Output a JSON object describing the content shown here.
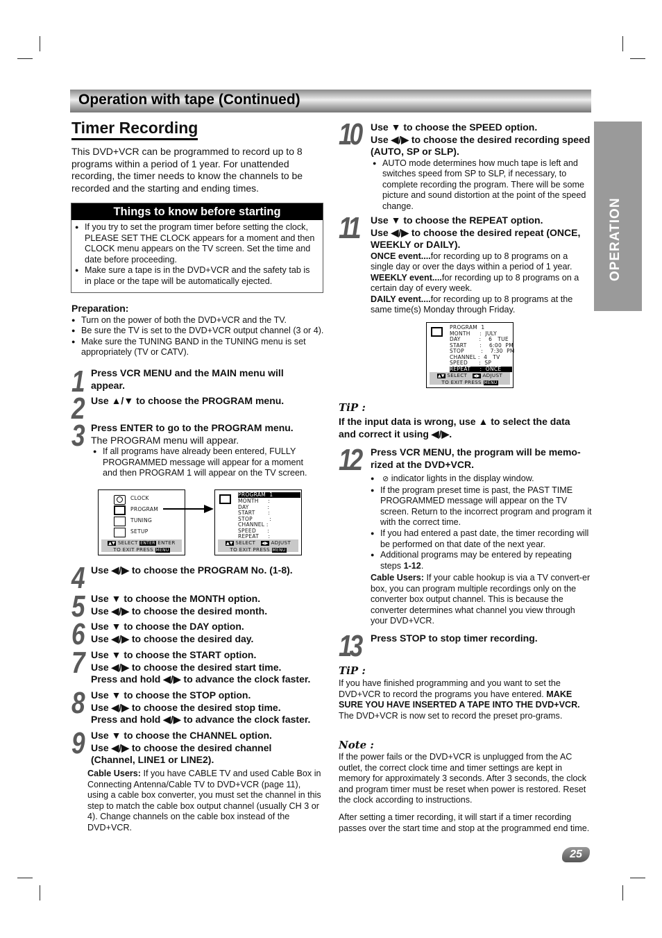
{
  "header": {
    "title": "Operation with tape (Continued)"
  },
  "section": {
    "title": "Timer Recording",
    "intro": "This DVD+VCR can be programmed to record up to 8 programs within a period of 1 year. For unattended recording, the timer needs to know the channels to be recorded and the starting and ending times."
  },
  "side_tab": {
    "label": "OPERATION"
  },
  "things": {
    "title": "Things to know before starting",
    "items": [
      "If you try to set the program timer before setting the clock, PLEASE SET THE CLOCK appears for a moment and then CLOCK menu appears on the TV screen. Set the time and date before proceeding.",
      "Make sure a tape is in the DVD+VCR and the safety tab is in place or the tape will  be automatically ejected."
    ]
  },
  "preparation": {
    "title": "Preparation:",
    "items": [
      "Turn on the power of both the DVD+VCR and the TV.",
      "Be sure the TV is set to the DVD+VCR output channel (3 or 4).",
      "Make sure the TUNING BAND in the TUNING menu is set appropriately (TV or CATV)."
    ]
  },
  "steps": {
    "s1": {
      "num": "1",
      "l1": "Press VCR MENU and the MAIN menu will appear."
    },
    "s2": {
      "num": "2",
      "l1": "Use ▲/▼ to choose the PROGRAM menu."
    },
    "s3": {
      "num": "3",
      "l1": "Press ENTER to go to the PROGRAM menu.",
      "body": "The PROGRAM menu will appear.",
      "bullet": "If all programs have already been entered, FULLY PROGRAMMED message will appear for a moment and then PROGRAM 1 will appear on the TV screen."
    },
    "s4": {
      "num": "4",
      "l1": "Use  ◀/▶ to choose the PROGRAM No. (1-8)."
    },
    "s5": {
      "num": "5",
      "l1": "Use ▼ to choose the MONTH option.",
      "l2": "Use ◀/▶ to choose the desired month."
    },
    "s6": {
      "num": "6",
      "l1": "Use ▼ to choose the DAY option.",
      "l2": "Use ◀/▶ to choose the desired day."
    },
    "s7": {
      "num": "7",
      "l1": "Use ▼ to choose the START option.",
      "l2": "Use ◀/▶ to choose the desired start time.",
      "l3": "Press and hold ◀/▶ to advance the clock faster."
    },
    "s8": {
      "num": "8",
      "l1": "Use ▼ to choose the STOP option.",
      "l2": "Use ◀/▶ to choose the desired stop time.",
      "l3": "Press and hold ◀/▶ to advance the clock faster."
    },
    "s9": {
      "num": "9",
      "l1": "Use ▼ to choose the CHANNEL option.",
      "l2": "Use ◀/▶ to choose the desired channel (Channel, LINE1 or LINE2).",
      "cable_label": "Cable Users:",
      "cable_text": " If you have CABLE TV and used Cable Box in Connecting Antenna/Cable TV to DVD+VCR (page 11), using a cable box converter, you must set the channel in this step to match the cable box output channel (usually CH 3 or 4). Change channels on the cable box instead of the DVD+VCR."
    },
    "s10": {
      "num": "10",
      "l1": "Use ▼ to choose the SPEED option.",
      "l2": "Use ◀/▶ to choose the desired recording speed (AUTO, SP or SLP).",
      "bullet": "AUTO mode determines how much tape is left and switches speed from SP to SLP, if necessary, to complete recording the program. There will be some picture and sound distortion at the point of the speed change."
    },
    "s11": {
      "num": "11",
      "l1": "Use ▼ to choose the REPEAT option.",
      "l2": "Use ◀/▶ to choose the desired repeat (ONCE, WEEKLY or DAILY).",
      "once_l": "ONCE event....",
      "once_t": "for recording up to 8 programs on a single day or over the days within a period of 1 year.",
      "weekly_l": "WEEKLY event....",
      "weekly_t": "for recording up to 8 programs on a certain day of every week.",
      "daily_l": "DAILY event....",
      "daily_t": "for recording up to 8 programs at the same time(s) Monday through Friday."
    },
    "s12": {
      "num": "12",
      "l1": "Press VCR MENU, the program will be memo-rized at the DVD+VCR.",
      "b1": " indicator lights in the display window.",
      "b2": "If the program preset time is past, the PAST TIME PROGRAMMED message will appear on the TV screen. Return to the incorrect program and program it with the correct time.",
      "b3": "If you had entered a past date, the timer recording will be performed on that date of the next year.",
      "b4a": "Additional programs may be entered by repeating steps ",
      "b4b": "1-12",
      "b4c": ".",
      "cable_label": "Cable Users:",
      "cable_text": " If your cable hookup is via a TV convert-er box, you can program multiple recordings only on the converter box output channel. This is because the converter determines what channel you view through your DVD+VCR."
    },
    "s13": {
      "num": "13",
      "l1": "Press STOP to stop timer recording."
    }
  },
  "tip1": {
    "title": "TiP :",
    "text": "If the input data is wrong, use ▲ to select the data and correct it using ◀/▶."
  },
  "tip2": {
    "title": "TiP :",
    "t1": "If you have finished programming and you want to set the DVD+VCR to record the programs you have entered. ",
    "t2": "MAKE SURE YOU HAVE INSERTED A TAPE INTO THE DVD+VCR.",
    "t3": " The DVD+VCR is now set to record the preset pro-grams."
  },
  "note": {
    "title": "Note :",
    "p1": "If the power fails or the DVD+VCR is unplugged from the AC outlet, the correct clock time and timer settings are kept in memory for approximately 3 seconds. After 3 seconds, the clock and program timer must be reset when power is restored. Reset the clock according to instructions.",
    "p2": "After setting a timer recording, it will start if a timer recording passes over the start time and stop at the programmed end time."
  },
  "screens": {
    "main_menu": {
      "items": [
        "CLOCK",
        "PROGRAM",
        "TUNING",
        "SETUP"
      ],
      "select": "SELECT",
      "enter_key": "ENTER",
      "enter": "ENTER",
      "exit": "TO  EXIT PRESS",
      "menu_key": "MENU"
    },
    "program_menu": {
      "rows": [
        "PROGRAM  1",
        "MONTH     :",
        "DAY          :",
        "START       :",
        "STOP         :",
        "CHANNEL :",
        "SPEED      :",
        "REPEAT     :"
      ],
      "select": "SELECT",
      "adjust": "ADJUST",
      "exit": "TO  EXIT  PRESS",
      "menu_key": "MENU"
    },
    "program_filled": {
      "rows": [
        "PROGRAM  1",
        "MONTH     :  JULY",
        "DAY          :    6   TUE",
        "START       :    6:00  PM",
        "STOP         :    7:30  PM",
        "CHANNEL :  4   TV",
        "SPEED      :  SP",
        "REPEAT     :  ONCE"
      ],
      "select": "SELECT",
      "adjust": "ADJUST",
      "exit": "TO  EXIT  PRESS",
      "menu_key": "MENU"
    }
  },
  "page_number": "25"
}
